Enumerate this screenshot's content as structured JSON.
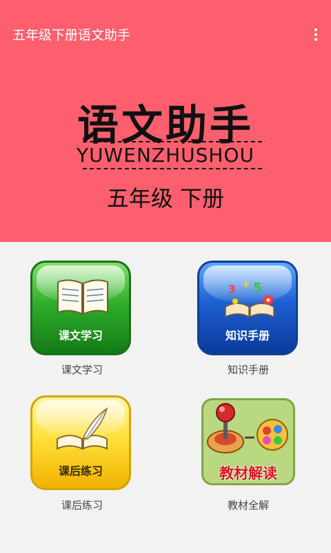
{
  "app_bar": {
    "title": "五年级下册语文助手",
    "menu_icon": "overflow-menu-icon"
  },
  "header": {
    "title": "语文助手",
    "subtitle": "YUWENZHUSHOU",
    "grade": "五年级 下册",
    "background": "#fd5f6e"
  },
  "tiles": [
    {
      "label": "课文学习",
      "caption": "课文学习",
      "icon": "open-book-icon",
      "color": "#2fae2b"
    },
    {
      "label": "知识手册",
      "caption": "知识手册",
      "icon": "knowledge-book-icon",
      "color": "#1c5fd1"
    },
    {
      "label": "课后练习",
      "caption": "课后练习",
      "icon": "quill-book-icon",
      "color": "#ffe03a"
    },
    {
      "label": "教材解读",
      "caption": "教材全解",
      "icon": "joystick-icon",
      "color": "#b9d880"
    }
  ]
}
